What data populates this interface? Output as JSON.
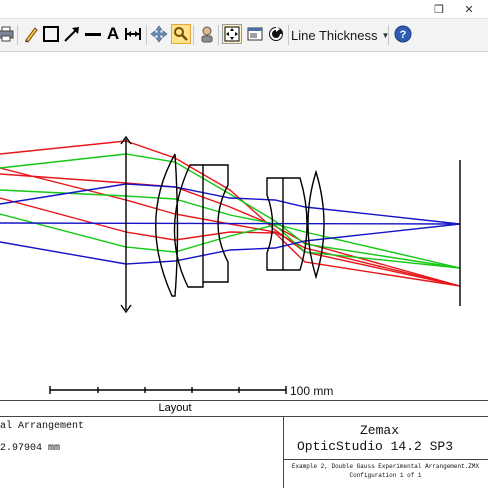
{
  "window": {
    "restore_glyph": "❐",
    "close_glyph": "✕"
  },
  "toolbar": {
    "line_thickness_label": "Line Thickness",
    "help_label": "?",
    "text_tool_label": "A",
    "icons": [
      "print-icon",
      "pencil-icon",
      "rectangle-icon",
      "arrow-icon",
      "line-icon",
      "text-icon",
      "dimension-icon",
      "move-icon",
      "zoom-icon",
      "settings-icon",
      "fit-window-icon",
      "window-icon",
      "refresh-icon",
      "help-icon"
    ]
  },
  "plot": {
    "scale_label": "100 mm",
    "colors": {
      "red": "#e8161a",
      "green": "#14c814",
      "blue": "#1414c8",
      "black": "#000000"
    }
  },
  "footer": {
    "section_label": "Layout",
    "arrangement_label": "al Arrangement",
    "value_label": "2.97904 mm",
    "brand": "Zemax",
    "product": "OpticStudio 14.2 SP3",
    "file_name": "Example 2, Double Gauss Experimental Arrangement.ZMX",
    "configuration": "Configuration 1 of 1"
  }
}
